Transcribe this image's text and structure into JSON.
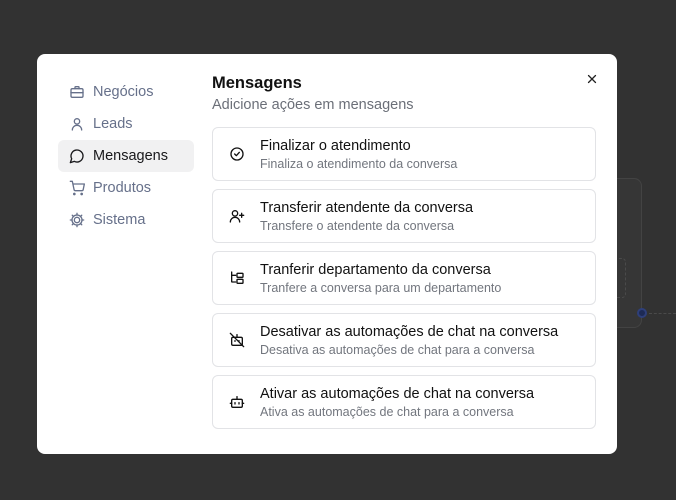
{
  "sidebar": {
    "items": [
      {
        "label": "Negócios",
        "icon": "briefcase-icon",
        "active": false
      },
      {
        "label": "Leads",
        "icon": "user-icon",
        "active": false
      },
      {
        "label": "Mensagens",
        "icon": "message-circle-icon",
        "active": true
      },
      {
        "label": "Produtos",
        "icon": "shopping-cart-icon",
        "active": false
      },
      {
        "label": "Sistema",
        "icon": "cog-icon",
        "active": false
      }
    ]
  },
  "main": {
    "title": "Mensagens",
    "subtitle": "Adicione ações em mensagens",
    "actions": [
      {
        "title": "Finalizar o atendimento",
        "description": "Finaliza o atendimento da conversa",
        "icon": "circle-check-icon"
      },
      {
        "title": "Transferir atendente da conversa",
        "description": "Transfere o atendente da conversa",
        "icon": "user-plus-icon"
      },
      {
        "title": "Tranferir departamento da conversa",
        "description": "Tranfere a conversa para um departamento",
        "icon": "folder-tree-icon"
      },
      {
        "title": "Desativar as automações de chat na conversa",
        "description": "Desativa as automações de chat para a conversa",
        "icon": "bot-off-icon"
      },
      {
        "title": "Ativar as automações de chat na conversa",
        "description": "Ativa as automações de chat para a conversa",
        "icon": "bot-icon"
      }
    ]
  },
  "colors": {
    "backdrop": "#323232",
    "active_item_bg": "#f1f1f2",
    "muted_text": "#66708a",
    "border": "#e2e3e6"
  }
}
